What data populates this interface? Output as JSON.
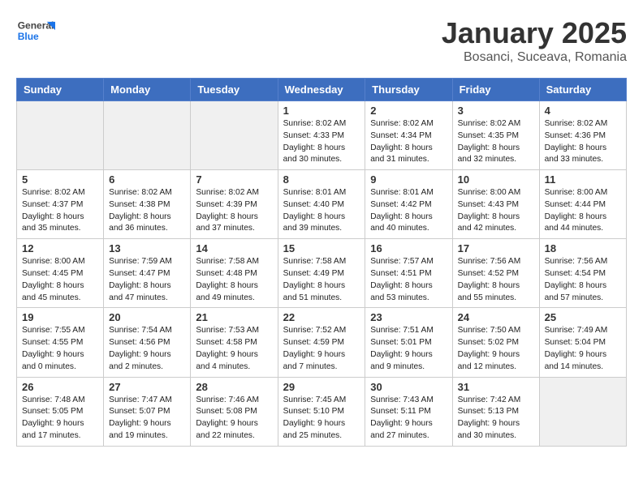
{
  "header": {
    "logo_general": "General",
    "logo_blue": "Blue",
    "month": "January 2025",
    "location": "Bosanci, Suceava, Romania"
  },
  "weekdays": [
    "Sunday",
    "Monday",
    "Tuesday",
    "Wednesday",
    "Thursday",
    "Friday",
    "Saturday"
  ],
  "weeks": [
    [
      {
        "day": "",
        "info": ""
      },
      {
        "day": "",
        "info": ""
      },
      {
        "day": "",
        "info": ""
      },
      {
        "day": "1",
        "info": "Sunrise: 8:02 AM\nSunset: 4:33 PM\nDaylight: 8 hours\nand 30 minutes."
      },
      {
        "day": "2",
        "info": "Sunrise: 8:02 AM\nSunset: 4:34 PM\nDaylight: 8 hours\nand 31 minutes."
      },
      {
        "day": "3",
        "info": "Sunrise: 8:02 AM\nSunset: 4:35 PM\nDaylight: 8 hours\nand 32 minutes."
      },
      {
        "day": "4",
        "info": "Sunrise: 8:02 AM\nSunset: 4:36 PM\nDaylight: 8 hours\nand 33 minutes."
      }
    ],
    [
      {
        "day": "5",
        "info": "Sunrise: 8:02 AM\nSunset: 4:37 PM\nDaylight: 8 hours\nand 35 minutes."
      },
      {
        "day": "6",
        "info": "Sunrise: 8:02 AM\nSunset: 4:38 PM\nDaylight: 8 hours\nand 36 minutes."
      },
      {
        "day": "7",
        "info": "Sunrise: 8:02 AM\nSunset: 4:39 PM\nDaylight: 8 hours\nand 37 minutes."
      },
      {
        "day": "8",
        "info": "Sunrise: 8:01 AM\nSunset: 4:40 PM\nDaylight: 8 hours\nand 39 minutes."
      },
      {
        "day": "9",
        "info": "Sunrise: 8:01 AM\nSunset: 4:42 PM\nDaylight: 8 hours\nand 40 minutes."
      },
      {
        "day": "10",
        "info": "Sunrise: 8:00 AM\nSunset: 4:43 PM\nDaylight: 8 hours\nand 42 minutes."
      },
      {
        "day": "11",
        "info": "Sunrise: 8:00 AM\nSunset: 4:44 PM\nDaylight: 8 hours\nand 44 minutes."
      }
    ],
    [
      {
        "day": "12",
        "info": "Sunrise: 8:00 AM\nSunset: 4:45 PM\nDaylight: 8 hours\nand 45 minutes."
      },
      {
        "day": "13",
        "info": "Sunrise: 7:59 AM\nSunset: 4:47 PM\nDaylight: 8 hours\nand 47 minutes."
      },
      {
        "day": "14",
        "info": "Sunrise: 7:58 AM\nSunset: 4:48 PM\nDaylight: 8 hours\nand 49 minutes."
      },
      {
        "day": "15",
        "info": "Sunrise: 7:58 AM\nSunset: 4:49 PM\nDaylight: 8 hours\nand 51 minutes."
      },
      {
        "day": "16",
        "info": "Sunrise: 7:57 AM\nSunset: 4:51 PM\nDaylight: 8 hours\nand 53 minutes."
      },
      {
        "day": "17",
        "info": "Sunrise: 7:56 AM\nSunset: 4:52 PM\nDaylight: 8 hours\nand 55 minutes."
      },
      {
        "day": "18",
        "info": "Sunrise: 7:56 AM\nSunset: 4:54 PM\nDaylight: 8 hours\nand 57 minutes."
      }
    ],
    [
      {
        "day": "19",
        "info": "Sunrise: 7:55 AM\nSunset: 4:55 PM\nDaylight: 9 hours\nand 0 minutes."
      },
      {
        "day": "20",
        "info": "Sunrise: 7:54 AM\nSunset: 4:56 PM\nDaylight: 9 hours\nand 2 minutes."
      },
      {
        "day": "21",
        "info": "Sunrise: 7:53 AM\nSunset: 4:58 PM\nDaylight: 9 hours\nand 4 minutes."
      },
      {
        "day": "22",
        "info": "Sunrise: 7:52 AM\nSunset: 4:59 PM\nDaylight: 9 hours\nand 7 minutes."
      },
      {
        "day": "23",
        "info": "Sunrise: 7:51 AM\nSunset: 5:01 PM\nDaylight: 9 hours\nand 9 minutes."
      },
      {
        "day": "24",
        "info": "Sunrise: 7:50 AM\nSunset: 5:02 PM\nDaylight: 9 hours\nand 12 minutes."
      },
      {
        "day": "25",
        "info": "Sunrise: 7:49 AM\nSunset: 5:04 PM\nDaylight: 9 hours\nand 14 minutes."
      }
    ],
    [
      {
        "day": "26",
        "info": "Sunrise: 7:48 AM\nSunset: 5:05 PM\nDaylight: 9 hours\nand 17 minutes."
      },
      {
        "day": "27",
        "info": "Sunrise: 7:47 AM\nSunset: 5:07 PM\nDaylight: 9 hours\nand 19 minutes."
      },
      {
        "day": "28",
        "info": "Sunrise: 7:46 AM\nSunset: 5:08 PM\nDaylight: 9 hours\nand 22 minutes."
      },
      {
        "day": "29",
        "info": "Sunrise: 7:45 AM\nSunset: 5:10 PM\nDaylight: 9 hours\nand 25 minutes."
      },
      {
        "day": "30",
        "info": "Sunrise: 7:43 AM\nSunset: 5:11 PM\nDaylight: 9 hours\nand 27 minutes."
      },
      {
        "day": "31",
        "info": "Sunrise: 7:42 AM\nSunset: 5:13 PM\nDaylight: 9 hours\nand 30 minutes."
      },
      {
        "day": "",
        "info": ""
      }
    ]
  ]
}
